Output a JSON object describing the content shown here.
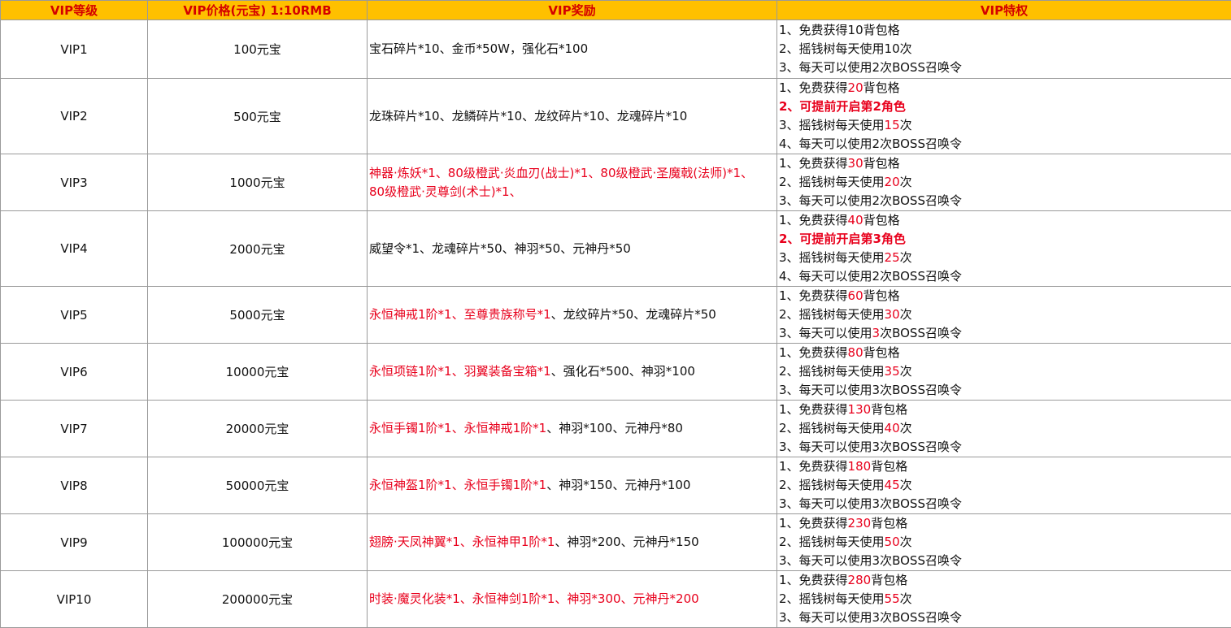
{
  "colors": {
    "header_bg": "#ffc000",
    "header_text": "#d40000",
    "highlight": "#e8001c",
    "grid": "#9a9a9a"
  },
  "headers": [
    "VIP等级",
    "VIP价格(元宝)  1:10RMB",
    "VIP奖励",
    "VIP特权"
  ],
  "rows": [
    {
      "level": "VIP1",
      "price": "100元宝",
      "reward": [
        [
          {
            "t": "宝石碎片*10、金币*50W，强化石*100"
          }
        ]
      ],
      "privileges": [
        [
          {
            "t": "1、免费获得10背包格"
          }
        ],
        [
          {
            "t": "2、摇钱树每天使用10次"
          }
        ],
        [
          {
            "t": "3、每天可以使用2次BOSS召唤令"
          }
        ]
      ]
    },
    {
      "level": "VIP2",
      "price": "500元宝",
      "reward": [
        [
          {
            "t": "龙珠碎片*10、龙鳞碎片*10、龙纹碎片*10、龙魂碎片*10"
          }
        ]
      ],
      "privileges": [
        [
          {
            "t": "1、免费获得"
          },
          {
            "t": "20",
            "s": "red"
          },
          {
            "t": "背包格"
          }
        ],
        [
          {
            "t": "2、可提前开启第2角色",
            "s": "red bold"
          }
        ],
        [
          {
            "t": "3、摇钱树每天使用"
          },
          {
            "t": "15",
            "s": "red"
          },
          {
            "t": "次"
          }
        ],
        [
          {
            "t": "4、每天可以使用2次BOSS召唤令"
          }
        ]
      ]
    },
    {
      "level": "VIP3",
      "price": "1000元宝",
      "reward": [
        [
          {
            "t": "神器·炼妖*1、80级橙武·炎血刃(战士)*1、80级橙武·圣魔戟(法师)*1、",
            "s": "red"
          }
        ],
        [
          {
            "t": "80级橙武·灵尊剑(术士)*1、",
            "s": "red"
          }
        ]
      ],
      "privileges": [
        [
          {
            "t": "1、免费获得"
          },
          {
            "t": "30",
            "s": "red"
          },
          {
            "t": "背包格"
          }
        ],
        [
          {
            "t": "2、摇钱树每天使用"
          },
          {
            "t": "20",
            "s": "red"
          },
          {
            "t": "次"
          }
        ],
        [
          {
            "t": "3、每天可以使用2次BOSS召唤令"
          }
        ]
      ]
    },
    {
      "level": "VIP4",
      "price": "2000元宝",
      "reward": [
        [
          {
            "t": "威望令*1、龙魂碎片*50、神羽*50、元神丹*50"
          }
        ]
      ],
      "privileges": [
        [
          {
            "t": "1、免费获得"
          },
          {
            "t": "40",
            "s": "red"
          },
          {
            "t": "背包格"
          }
        ],
        [
          {
            "t": "2、可提前开启第3角色",
            "s": "red bold"
          }
        ],
        [
          {
            "t": "3、摇钱树每天使用"
          },
          {
            "t": "25",
            "s": "red"
          },
          {
            "t": "次"
          }
        ],
        [
          {
            "t": "4、每天可以使用2次BOSS召唤令"
          }
        ]
      ]
    },
    {
      "level": "VIP5",
      "price": "5000元宝",
      "reward": [
        [
          {
            "t": "永恒神戒1阶*1、至尊贵族称号*1",
            "s": "red"
          },
          {
            "t": "、龙纹碎片*50、龙魂碎片*50"
          }
        ]
      ],
      "privileges": [
        [
          {
            "t": "1、免费获得"
          },
          {
            "t": "60",
            "s": "red"
          },
          {
            "t": "背包格"
          }
        ],
        [
          {
            "t": "2、摇钱树每天使用"
          },
          {
            "t": "30",
            "s": "red"
          },
          {
            "t": "次"
          }
        ],
        [
          {
            "t": "3、每天可以使用"
          },
          {
            "t": "3",
            "s": "red"
          },
          {
            "t": "次BOSS召唤令"
          }
        ]
      ]
    },
    {
      "level": "VIP6",
      "price": "10000元宝",
      "reward": [
        [
          {
            "t": "永恒项链1阶*1、羽翼装备宝箱*1",
            "s": "red"
          },
          {
            "t": "、强化石*500、神羽*100"
          }
        ]
      ],
      "privileges": [
        [
          {
            "t": "1、免费获得"
          },
          {
            "t": "80",
            "s": "red"
          },
          {
            "t": "背包格"
          }
        ],
        [
          {
            "t": "2、摇钱树每天使用"
          },
          {
            "t": "35",
            "s": "red"
          },
          {
            "t": "次"
          }
        ],
        [
          {
            "t": "3、每天可以使用3次BOSS召唤令"
          }
        ]
      ]
    },
    {
      "level": "VIP7",
      "price": "20000元宝",
      "reward": [
        [
          {
            "t": "永恒手镯1阶*1、永恒神戒1阶*1",
            "s": "red"
          },
          {
            "t": "、神羽*100、元神丹*80"
          }
        ]
      ],
      "privileges": [
        [
          {
            "t": "1、免费获得"
          },
          {
            "t": "130",
            "s": "red"
          },
          {
            "t": "背包格"
          }
        ],
        [
          {
            "t": "2、摇钱树每天使用"
          },
          {
            "t": "40",
            "s": "red"
          },
          {
            "t": "次"
          }
        ],
        [
          {
            "t": "3、每天可以使用3次BOSS召唤令"
          }
        ]
      ]
    },
    {
      "level": "VIP8",
      "price": "50000元宝",
      "reward": [
        [
          {
            "t": "永恒神盔1阶*1、永恒手镯1阶*1",
            "s": "red"
          },
          {
            "t": "、神羽*150、元神丹*100"
          }
        ]
      ],
      "privileges": [
        [
          {
            "t": "1、免费获得"
          },
          {
            "t": "180",
            "s": "red"
          },
          {
            "t": "背包格"
          }
        ],
        [
          {
            "t": "2、摇钱树每天使用"
          },
          {
            "t": "45",
            "s": "red"
          },
          {
            "t": "次"
          }
        ],
        [
          {
            "t": "3、每天可以使用3次BOSS召唤令"
          }
        ]
      ]
    },
    {
      "level": "VIP9",
      "price": "100000元宝",
      "reward": [
        [
          {
            "t": "翅膀·天凤神翼*1、永恒神甲1阶*1",
            "s": "red"
          },
          {
            "t": "、神羽*200、元神丹*150"
          }
        ]
      ],
      "privileges": [
        [
          {
            "t": "1、免费获得"
          },
          {
            "t": "230",
            "s": "red"
          },
          {
            "t": "背包格"
          }
        ],
        [
          {
            "t": "2、摇钱树每天使用"
          },
          {
            "t": "50",
            "s": "red"
          },
          {
            "t": "次"
          }
        ],
        [
          {
            "t": "3、每天可以使用3次BOSS召唤令"
          }
        ]
      ]
    },
    {
      "level": "VIP10",
      "price": "200000元宝",
      "reward": [
        [
          {
            "t": "时装·魔灵化装*1、永恒神剑1阶*1、神羽*300、元神丹*200",
            "s": "red"
          }
        ]
      ],
      "privileges": [
        [
          {
            "t": "1、免费获得"
          },
          {
            "t": "280",
            "s": "red"
          },
          {
            "t": "背包格"
          }
        ],
        [
          {
            "t": "2、摇钱树每天使用"
          },
          {
            "t": "55",
            "s": "red"
          },
          {
            "t": "次"
          }
        ],
        [
          {
            "t": "3、每天可以使用3次BOSS召唤令"
          }
        ]
      ]
    }
  ]
}
